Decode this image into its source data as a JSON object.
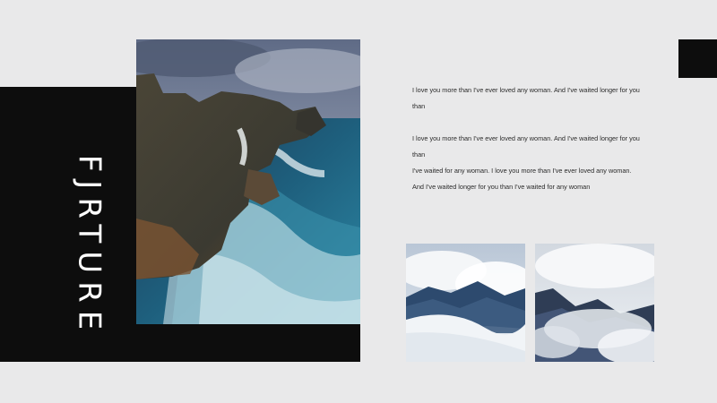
{
  "slide": {
    "title": "FJRTURE",
    "paragraph_1": "I love you more than I've ever loved any woman. And I've waited longer for you than",
    "paragraph_2_line_1": "I love you more than I've ever loved any woman. And I've waited longer for you than",
    "paragraph_2_line_2": "I've waited for any woman. I love you more than I've ever loved any woman.",
    "paragraph_2_line_3": "And I've waited longer for you than I've waited for any woman"
  },
  "images": {
    "main": "coastal-cliffs-waves",
    "thumb_1": "snowy-mountain-clouds",
    "thumb_2": "misty-mountain-peaks"
  },
  "colors": {
    "background": "#e9e9ea",
    "band": "#0d0d0d",
    "title_text": "#ffffff",
    "body_text": "#2a2a2a"
  }
}
